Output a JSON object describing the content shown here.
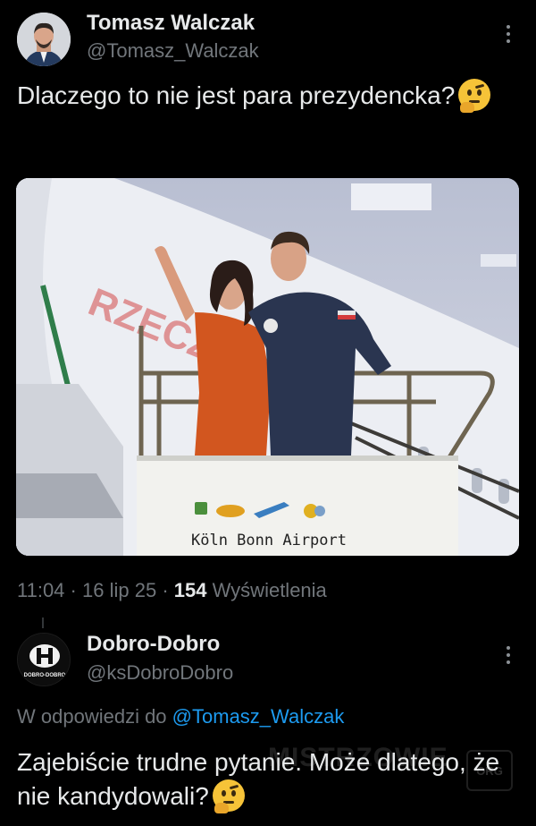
{
  "tweet": {
    "author_name": "Tomasz Walczak",
    "author_handle": "@Tomasz_Walczak",
    "text": "Dlaczego to nie jest para prezydencka?",
    "emoji": "thinking-face-icon",
    "photo": {
      "sign_text": "Köln Bonn Airport",
      "fuselage_text": "RZECZ"
    },
    "time": "11:04",
    "date": "16 lip 25",
    "views_count": "154",
    "views_label": "Wyświetlenia"
  },
  "reply": {
    "author_name": "Dobro-Dobro",
    "author_handle": "@ksDobroDobro",
    "avatar_text": "DOBRO-DOBRO",
    "reply_to_label": "W odpowiedzi do",
    "reply_to_handle": "@Tomasz_Walczak",
    "text": "Zajebiście trudne pytanie. Może dlatego, że nie kandydowali?",
    "emoji": "thinking-face-icon"
  },
  "watermark": {
    "text": "MISTRZOWIE",
    "badge": "ORG"
  },
  "colors": {
    "background": "#000000",
    "text": "#e7e9ea",
    "secondary": "#71767b",
    "link": "#1d9bf0"
  }
}
